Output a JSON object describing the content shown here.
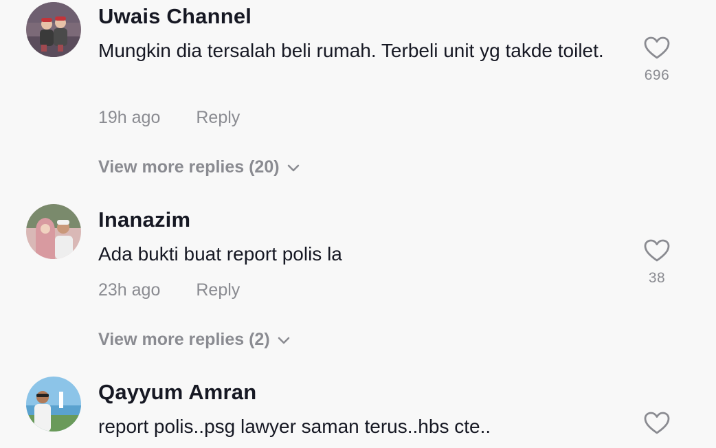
{
  "comments": [
    {
      "username": "Uwais Channel",
      "text": "Mungkin dia tersalah beli rumah. Terbeli unit yg takde toilet.",
      "time": "19h ago",
      "reply_label": "Reply",
      "view_more": "View more replies (20)",
      "likes": "696",
      "avatar_icon": "avatar-kids-photo"
    },
    {
      "username": "Inanazim",
      "text": "Ada bukti buat report polis la",
      "time": "23h ago",
      "reply_label": "Reply",
      "view_more": "View more replies (2)",
      "likes": "38",
      "avatar_icon": "avatar-couple-photo"
    },
    {
      "username": "Qayyum Amran",
      "text": "report polis..psg lawyer saman terus..hbs cte..",
      "avatar_icon": "avatar-beach-photo"
    }
  ],
  "colors": {
    "background": "#f8f8f8",
    "text_primary": "#161823",
    "text_secondary": "#8a8b91"
  }
}
